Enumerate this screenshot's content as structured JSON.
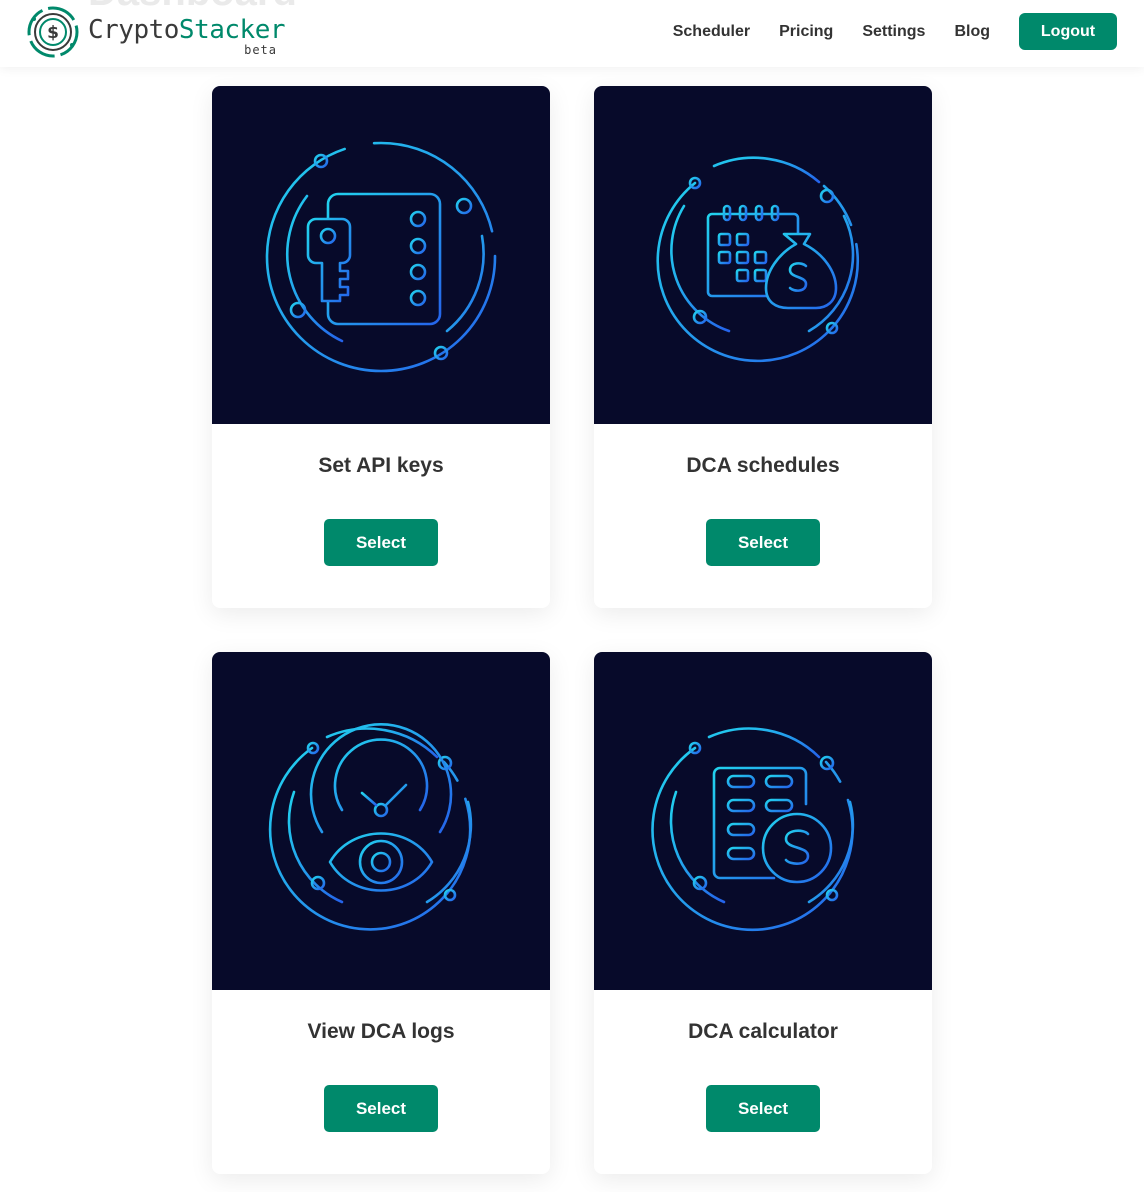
{
  "page": {
    "ghost_heading": "Dashboard"
  },
  "logo": {
    "word_main": "Crypto",
    "word_accent": "Stacker",
    "beta": "beta",
    "icon": "dollar-coin-circuit-icon"
  },
  "nav": {
    "items": [
      {
        "label": "Scheduler"
      },
      {
        "label": "Pricing"
      },
      {
        "label": "Settings"
      },
      {
        "label": "Blog"
      }
    ],
    "logout_label": "Logout"
  },
  "colors": {
    "brand": "#00896b",
    "card_image_bg": "#070a2a",
    "icon_gradient_start": "#22d3ee",
    "icon_gradient_end": "#2563eb"
  },
  "cards": [
    {
      "title": "Set API keys",
      "icon": "api-key-list-icon",
      "button": "Select"
    },
    {
      "title": "DCA schedules",
      "icon": "calendar-money-bag-icon",
      "button": "Select"
    },
    {
      "title": "View DCA logs",
      "icon": "clock-eye-icon",
      "button": "Select"
    },
    {
      "title": "DCA calculator",
      "icon": "calculator-dollar-icon",
      "button": "Select"
    }
  ]
}
